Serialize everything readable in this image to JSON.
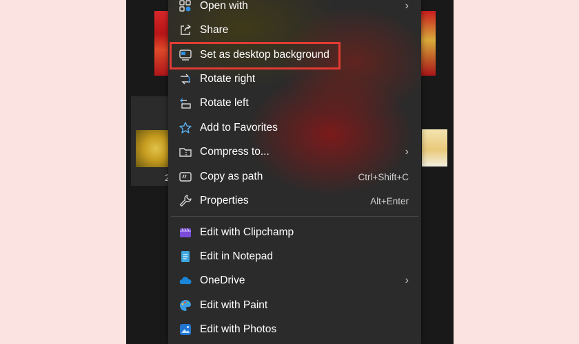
{
  "menu": {
    "items": [
      {
        "label": "Open with",
        "icon": "open-with-icon",
        "submenu": true
      },
      {
        "label": "Share",
        "icon": "share-icon"
      },
      {
        "label": "Set as desktop background",
        "icon": "desktop-background-icon",
        "highlighted": true
      },
      {
        "label": "Rotate right",
        "icon": "rotate-right-icon"
      },
      {
        "label": "Rotate left",
        "icon": "rotate-left-icon"
      },
      {
        "label": "Add to Favorites",
        "icon": "star-icon"
      },
      {
        "label": "Compress to...",
        "icon": "compress-icon",
        "submenu": true
      },
      {
        "label": "Copy as path",
        "icon": "copy-path-icon",
        "shortcut": "Ctrl+Shift+C"
      },
      {
        "label": "Properties",
        "icon": "wrench-icon",
        "shortcut": "Alt+Enter"
      },
      {
        "label": "Edit with Clipchamp",
        "icon": "clipchamp-icon"
      },
      {
        "label": "Edit in Notepad",
        "icon": "notepad-icon"
      },
      {
        "label": "OneDrive",
        "icon": "onedrive-icon",
        "submenu": true
      },
      {
        "label": "Edit with Paint",
        "icon": "paint-icon"
      },
      {
        "label": "Edit with Photos",
        "icon": "photos-icon"
      }
    ]
  },
  "explorer": {
    "tile_caption": "2"
  },
  "colors": {
    "highlight_border": "#e23b33",
    "menu_background": "#2b2b2b",
    "page_background": "#fbe3e1"
  }
}
